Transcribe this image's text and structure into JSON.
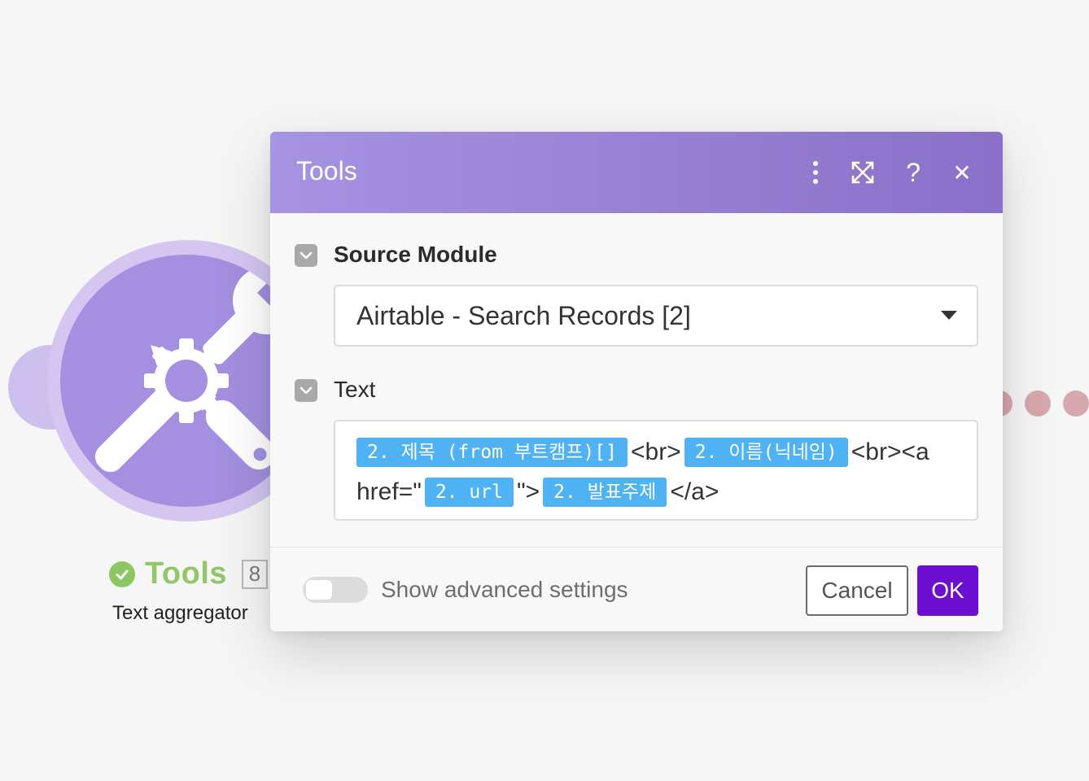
{
  "background_module": {
    "name": "Tools",
    "badge": "8",
    "subtitle": "Text aggregator",
    "status_icon": "check-circle-icon",
    "icon": "tools-icon"
  },
  "dialog": {
    "title": "Tools",
    "header_actions": [
      "more-vertical-icon",
      "expand-icon",
      "help-icon",
      "close-icon"
    ],
    "help_symbol": "?",
    "close_symbol": "✕",
    "source_module": {
      "label": "Source Module",
      "value": "Airtable - Search Records [2]"
    },
    "text_field": {
      "label": "Text",
      "segments": [
        {
          "type": "pill",
          "text": "2. 제목 (from 부트캠프)[]"
        },
        {
          "type": "text",
          "text": "<br>"
        },
        {
          "type": "pill",
          "text": "2. 이름(닉네임)"
        },
        {
          "type": "text",
          "text": "<br><a href=\""
        },
        {
          "type": "pill",
          "text": "2. url"
        },
        {
          "type": "text",
          "text": "\">"
        },
        {
          "type": "pill",
          "text": "2. 발표주제"
        },
        {
          "type": "text",
          "text": "</a>"
        }
      ]
    },
    "footer": {
      "advanced_label": "Show advanced settings",
      "advanced_enabled": false,
      "cancel_label": "Cancel",
      "ok_label": "OK"
    }
  },
  "colors": {
    "accent": "#6d0fd3",
    "header_start": "#a693e2",
    "header_end": "#8a70c8",
    "pill": "#4fb2f4",
    "success": "#8cc763"
  }
}
